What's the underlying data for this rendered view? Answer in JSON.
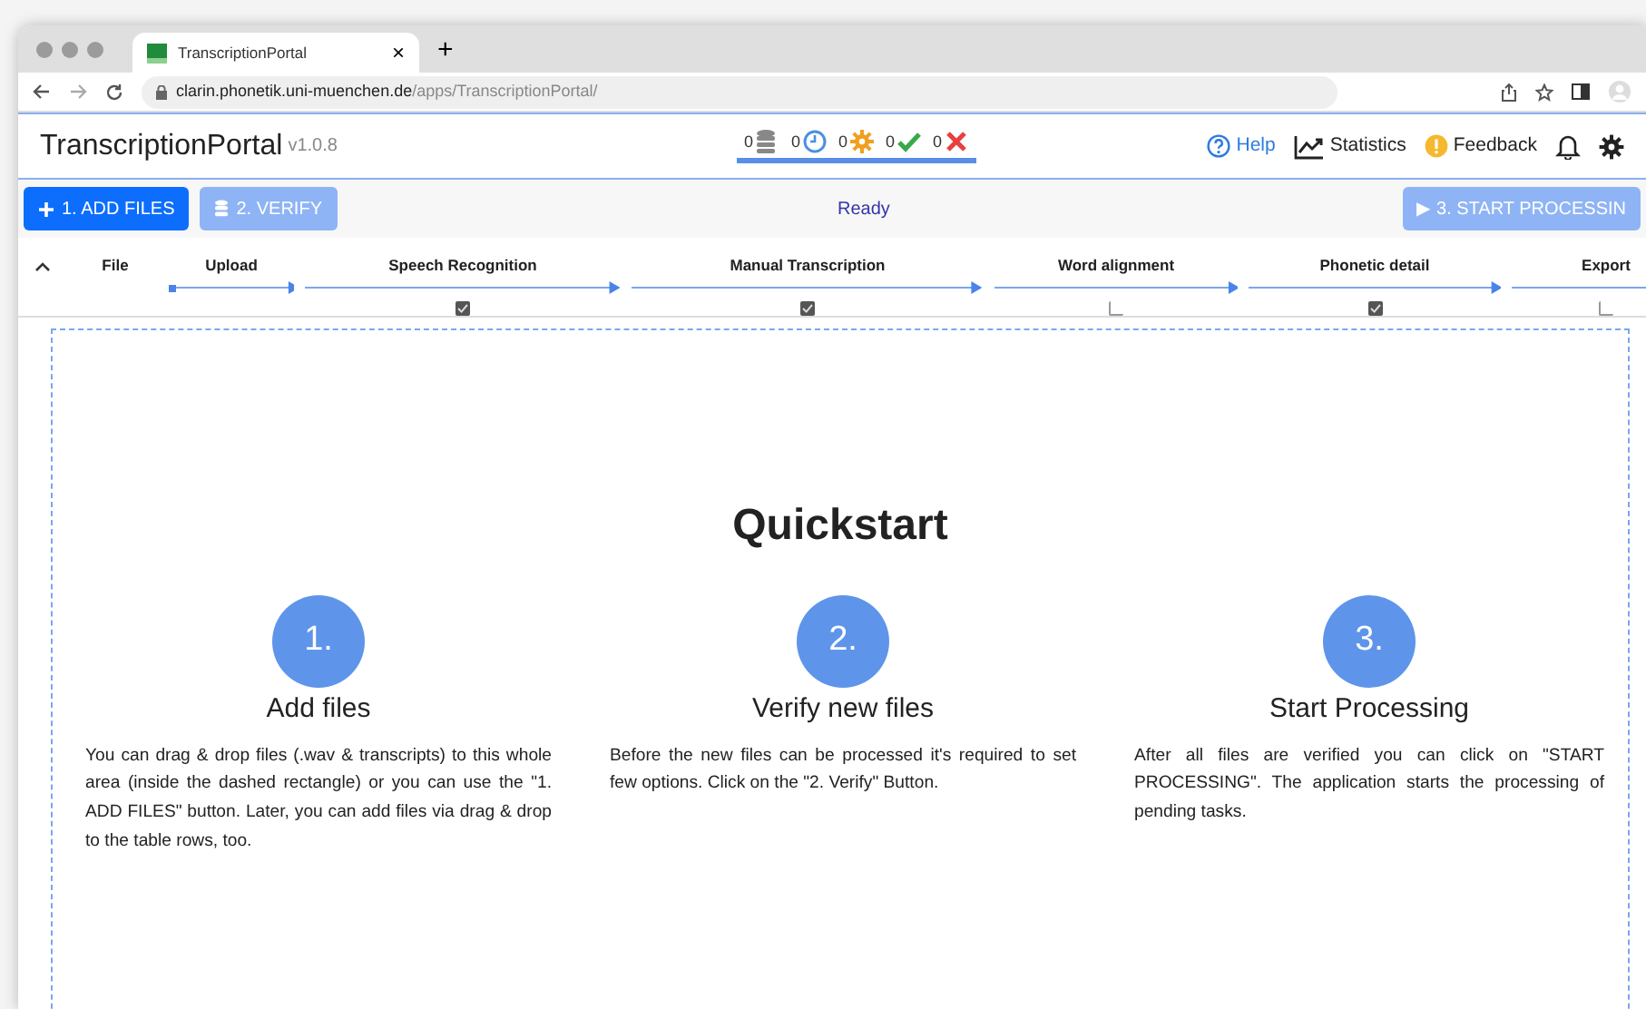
{
  "browser": {
    "tab_title": "TranscriptionPortal",
    "tab_close": "×",
    "new_tab": "+",
    "url_host": "clarin.phonetik.uni-muenchen.de",
    "url_path": "/apps/TranscriptionPortal/"
  },
  "header": {
    "title": "TranscriptionPortal",
    "version": "v1.0.8",
    "counters": [
      {
        "kind": "database",
        "count": "0",
        "color": "#888888"
      },
      {
        "kind": "clock",
        "count": "0",
        "color": "#4a90e2"
      },
      {
        "kind": "gear",
        "count": "0",
        "color": "#f0a020"
      },
      {
        "kind": "check",
        "count": "0",
        "color": "#3aa84a"
      },
      {
        "kind": "cross",
        "count": "0",
        "color": "#e84040"
      }
    ],
    "links": [
      {
        "kind": "help",
        "label": "Help"
      },
      {
        "kind": "statistics",
        "label": "Statistics"
      },
      {
        "kind": "feedback",
        "label": "Feedback"
      },
      {
        "kind": "bell"
      },
      {
        "kind": "gear"
      }
    ]
  },
  "toolbar": {
    "add_button": "1. ADD FILES",
    "verify_button": "2. VERIFY",
    "verify_disabled": true,
    "status": "Ready",
    "start_button": "▶ 3. START PROCESSIN",
    "start_disabled": true
  },
  "table": {
    "file_column": "File",
    "stages": [
      {
        "label": "Upload"
      },
      {
        "label": "Speech Recognition",
        "checked": true
      },
      {
        "label": "Manual Transcription",
        "checked": true
      },
      {
        "label": "Word alignment",
        "checked": false
      },
      {
        "label": "Phonetic detail",
        "checked": true
      },
      {
        "label": "Export",
        "checked": false
      }
    ]
  },
  "quickstart": {
    "title": "Quickstart",
    "steps": [
      {
        "number": "1.",
        "title": "Add files",
        "text": "You can drag & drop files (.wav & transcripts) to this whole area (inside the dashed rectangle) or you can use the \"1. ADD FILES\" button. Later, you can add files via drag & drop to the table rows, too."
      },
      {
        "number": "2.",
        "title": "Verify new files",
        "text": "Before the new files can be processed it's required to set few options. Click on the \"2. Verify\" Button."
      },
      {
        "number": "3.",
        "title": "Start Processing",
        "text": "After all files are verified you can click on \"START PROCESSING\". The application starts the processing of pending tasks."
      }
    ]
  }
}
